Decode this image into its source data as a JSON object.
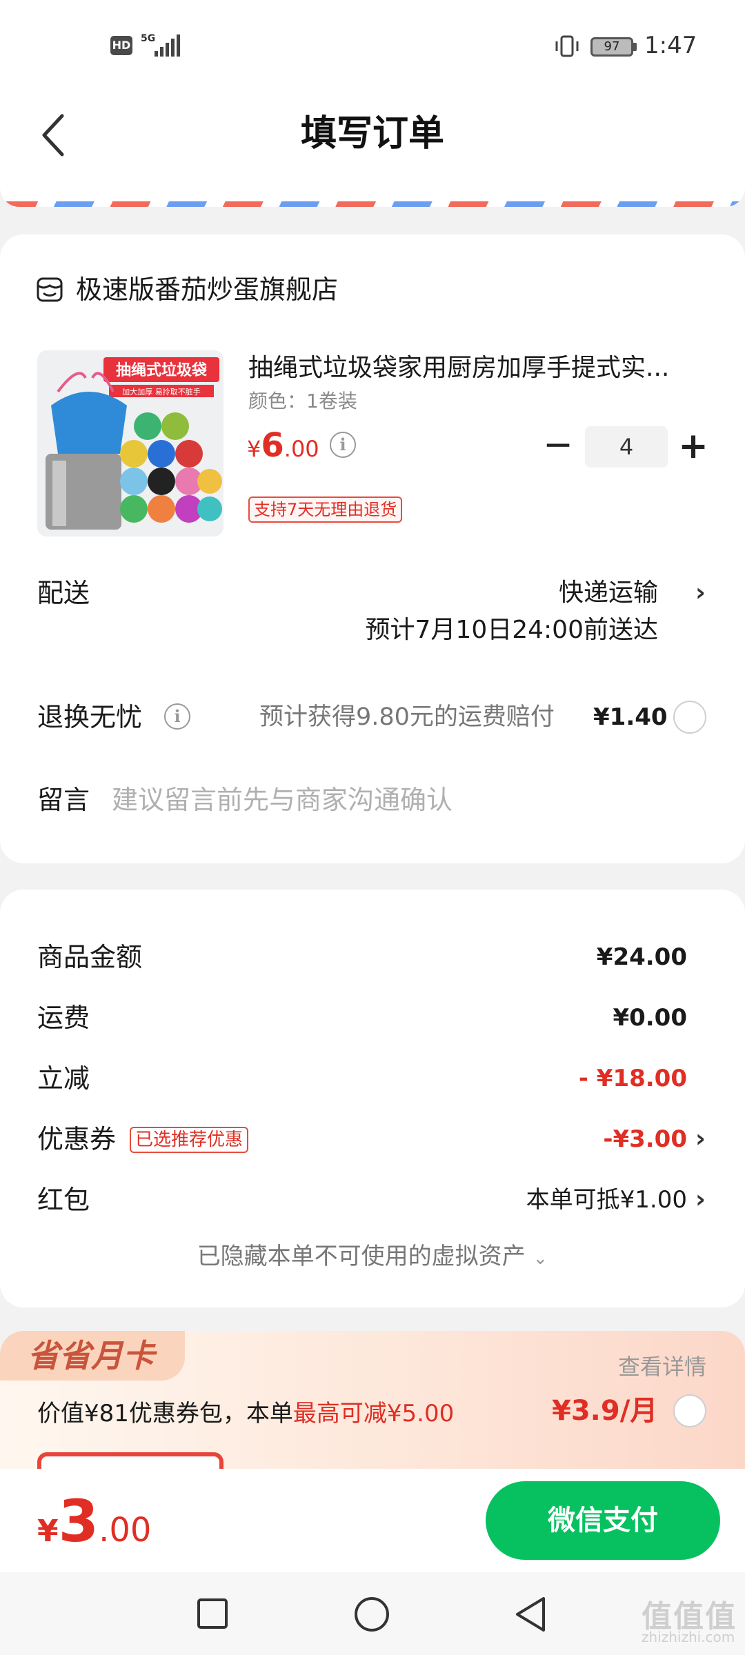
{
  "status_bar": {
    "hd": "HD",
    "network": "5G",
    "battery": "97",
    "time": "1:47"
  },
  "header": {
    "title": "填写订单",
    "back_icon": "chevron-left-icon"
  },
  "store": {
    "icon": "store-icon",
    "name": "极速版番茄炒蛋旗舰店"
  },
  "product": {
    "title": "抽绳式垃圾袋家用厨房加厚手提式实...",
    "spec": "颜色：1卷装",
    "price_currency": "¥",
    "price_int": "6",
    "price_dec": ".00",
    "quantity": "4",
    "minus": "−",
    "plus": "+",
    "return_tag": "支持7天无理由退货",
    "image": {
      "banner": "抽绳式垃圾袋",
      "sub": "加大加厚 易拎取不脏手"
    }
  },
  "delivery": {
    "label": "配送",
    "method": "快递运输",
    "eta": "预计7月10日24:00前送达"
  },
  "return_insurance": {
    "label": "退换无忧",
    "desc": "预计获得9.80元的运费赔付",
    "price": "¥1.40"
  },
  "message": {
    "label": "留言",
    "placeholder": "建议留言前先与商家沟通确认"
  },
  "summary": {
    "goods_label": "商品金额",
    "goods_value": "¥24.00",
    "shipping_label": "运费",
    "shipping_value": "¥0.00",
    "discount_label": "立减",
    "discount_value": "- ¥18.00",
    "coupon_label": "优惠券",
    "coupon_badge": "已选推荐优惠",
    "coupon_value": "-¥3.00",
    "redpacket_label": "红包",
    "redpacket_value": "本单可抵¥1.00",
    "hidden_assets": "已隐藏本单不可使用的虚拟资产"
  },
  "monthly_card": {
    "title": "省省月卡",
    "detail": "查看详情",
    "desc_prefix": "价值¥81优惠券包，本单",
    "desc_highlight": "最高可减¥5.00",
    "price": "¥3.9/月"
  },
  "pay_bar": {
    "currency": "¥",
    "total_int": "3",
    "total_dec": ".00",
    "pay_button": "微信支付"
  },
  "watermark": {
    "text": "值值值",
    "url": "zhizhizhi.com"
  },
  "colors": {
    "accent_red": "#e02e24",
    "wechat_green": "#07c160"
  }
}
